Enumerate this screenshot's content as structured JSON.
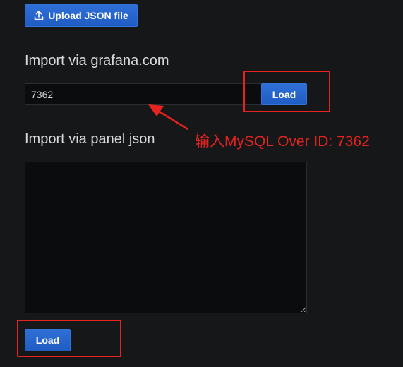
{
  "upload": {
    "label": "Upload JSON file",
    "icon": "upload-icon"
  },
  "grafana_import": {
    "title": "Import via grafana.com",
    "input_value": "7362",
    "load_label": "Load"
  },
  "panel_import": {
    "title": "Import via panel json",
    "textarea_value": "",
    "load_label": "Load"
  },
  "annotation": {
    "text": "输入MySQL Over ID: 7362",
    "color": "#e8231f"
  },
  "theme": {
    "background": "#161719",
    "button_primary": "#3274d9",
    "input_background": "#0b0c0e"
  }
}
